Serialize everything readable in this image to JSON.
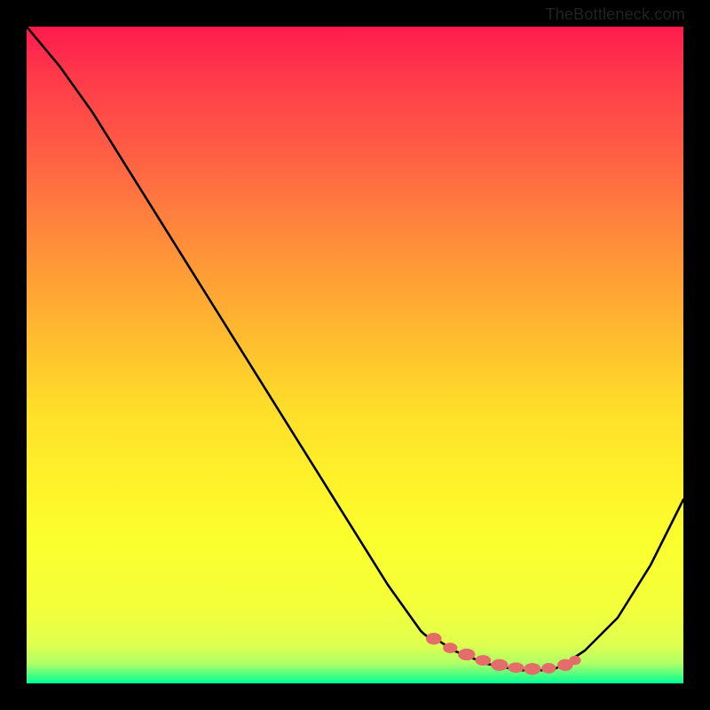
{
  "credit": "TheBottleneck.com",
  "chart_data": {
    "type": "line",
    "title": "",
    "xlabel": "",
    "ylabel": "",
    "xlim": [
      0,
      100
    ],
    "ylim": [
      0,
      100
    ],
    "series": [
      {
        "name": "bottleneck-curve",
        "x": [
          0,
          5,
          10,
          15,
          20,
          25,
          30,
          35,
          40,
          45,
          50,
          55,
          60,
          62,
          65,
          70,
          75,
          80,
          82,
          85,
          90,
          95,
          100
        ],
        "y": [
          100,
          94,
          87,
          79,
          71,
          63,
          55,
          47,
          39,
          31,
          23,
          15,
          8,
          7,
          5,
          3,
          2,
          2,
          3,
          5,
          10,
          18,
          28
        ]
      }
    ],
    "optimal_points": {
      "name": "optimal-range-dots",
      "x": [
        62,
        66,
        69,
        72,
        75,
        78,
        80,
        82
      ],
      "y": [
        7,
        5,
        4,
        3,
        2.5,
        2.5,
        2.5,
        3
      ]
    },
    "colors": {
      "curve": "#000000",
      "dots": "#e46d6a"
    }
  }
}
